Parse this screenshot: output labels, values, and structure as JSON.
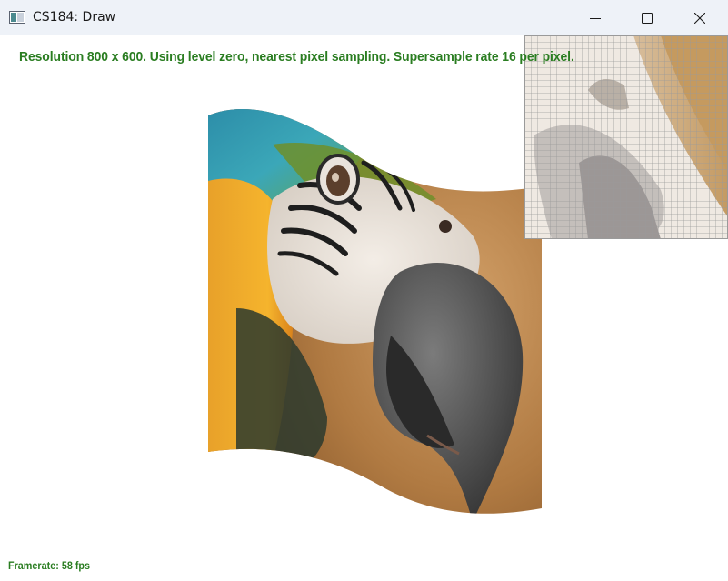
{
  "window": {
    "title": "CS184: Draw",
    "buttons": {
      "minimize": "minimize",
      "maximize": "maximize",
      "close": "close"
    }
  },
  "overlay": {
    "info_text": "Resolution 800 x 600. Using level zero, nearest pixel sampling. Supersample rate 16 per pixel.",
    "framerate_text": "Framerate: 58 fps",
    "text_color": "#2a7d21"
  },
  "icons": {
    "app": "window-app-icon",
    "minimize": "minimize-icon",
    "maximize": "maximize-icon",
    "close": "close-icon"
  }
}
